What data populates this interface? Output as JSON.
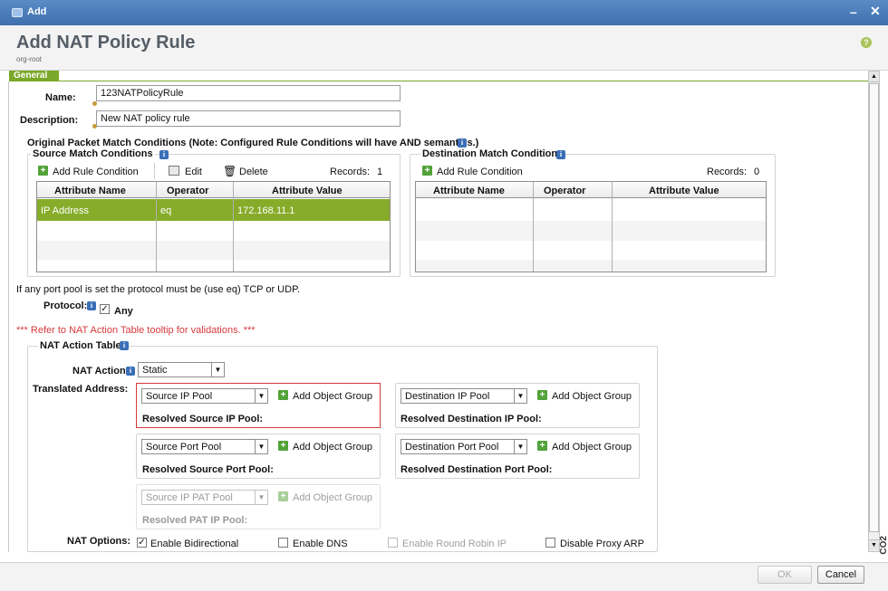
{
  "window": {
    "title": "Add"
  },
  "header": {
    "title": "Add NAT Policy Rule",
    "org": "org-root"
  },
  "tabs": [
    {
      "label": "General"
    }
  ],
  "form": {
    "name_label": "Name:",
    "name_value": "123NATPolicyRule",
    "description_label": "Description:",
    "description_value": "New NAT policy rule",
    "conditions_heading": "Original Packet Match Conditions (Note: Configured Rule Conditions will have AND semantics.)"
  },
  "source_match": {
    "title": "Source Match Conditions",
    "add_label": "Add Rule Condition",
    "edit_label": "Edit",
    "delete_label": "Delete",
    "records_label": "Records:",
    "records_count": "1",
    "columns": [
      "Attribute Name",
      "Operator",
      "Attribute Value"
    ],
    "rows": [
      {
        "name": "IP Address",
        "operator": "eq",
        "value": "172.168.11.1"
      }
    ]
  },
  "destination_match": {
    "title": "Destination Match Conditions",
    "add_label": "Add Rule Condition",
    "records_label": "Records:",
    "records_count": "0",
    "columns": [
      "Attribute Name",
      "Operator",
      "Attribute Value"
    ]
  },
  "port_pool_note": "If any port pool is set the protocol must be (use eq) TCP or UDP.",
  "protocol": {
    "label": "Protocol:",
    "any_label": "Any",
    "any_checked": true
  },
  "nat_note": "*** Refer to NAT Action Table tooltip for validations. ***",
  "nat_action_table": {
    "title": "NAT Action Table",
    "action_label": "NAT Action:",
    "action_value": "Static",
    "translated_label": "Translated Address:",
    "source_ip_pool": "Source IP Pool",
    "resolved_source_ip": "Resolved Source IP Pool:",
    "destination_ip_pool": "Destination IP Pool",
    "resolved_destination_ip": "Resolved Destination IP Pool:",
    "source_port_pool": "Source Port Pool",
    "resolved_source_port": "Resolved Source Port Pool:",
    "destination_port_pool": "Destination Port Pool",
    "resolved_destination_port": "Resolved Destination Port Pool:",
    "source_ip_pat_pool": "Source IP PAT Pool",
    "resolved_pat_ip": "Resolved PAT IP Pool:",
    "add_object_group": "Add Object Group"
  },
  "nat_options": {
    "label": "NAT Options:",
    "enable_bidirectional": "Enable Bidirectional",
    "enable_dns": "Enable DNS",
    "enable_round_robin": "Enable Round Robin IP",
    "disable_proxy_arp": "Disable Proxy ARP"
  },
  "footer": {
    "ok_label": "OK",
    "cancel_label": "Cancel"
  },
  "side_label": "CO2",
  "colors": {
    "accent_green": "#7aa828",
    "selected_row": "#86ac2a",
    "title_bar": "#3e6fae",
    "note_red": "#d6393c"
  }
}
